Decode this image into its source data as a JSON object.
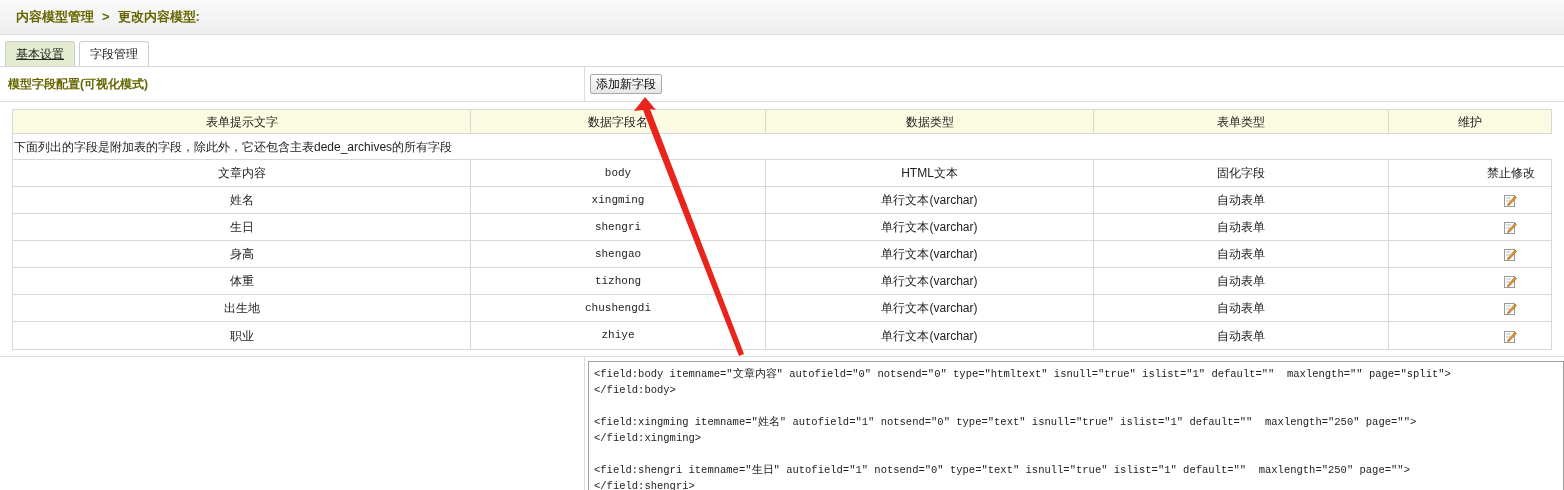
{
  "breadcrumb": {
    "parent": "内容模型管理",
    "separator": ">",
    "current": "更改内容模型:"
  },
  "tabs": [
    {
      "label": "基本设置",
      "selected": true
    },
    {
      "label": "字段管理",
      "selected": false
    }
  ],
  "section": {
    "title": "模型字段配置(可视化模式)",
    "button": "添加新字段"
  },
  "table": {
    "columns": [
      "表单提示文字",
      "数据字段名",
      "数据类型",
      "表单类型",
      "维护"
    ],
    "note": "下面列出的字段是附加表的字段，除此外，它还包含主表dede_archives的所有字段",
    "rows": [
      {
        "label": "文章内容",
        "field": "body",
        "data_type": "HTML文本",
        "form_type": "固化字段",
        "action": {
          "kind": "text",
          "text": "禁止修改"
        }
      },
      {
        "label": "姓名",
        "field": "xingming",
        "data_type": "单行文本(varchar)",
        "form_type": "自动表单",
        "action": {
          "kind": "edit"
        }
      },
      {
        "label": "生日",
        "field": "shengri",
        "data_type": "单行文本(varchar)",
        "form_type": "自动表单",
        "action": {
          "kind": "edit"
        }
      },
      {
        "label": "身高",
        "field": "shengao",
        "data_type": "单行文本(varchar)",
        "form_type": "自动表单",
        "action": {
          "kind": "edit"
        }
      },
      {
        "label": "体重",
        "field": "tizhong",
        "data_type": "单行文本(varchar)",
        "form_type": "自动表单",
        "action": {
          "kind": "edit"
        }
      },
      {
        "label": "出生地",
        "field": "chushengdi",
        "data_type": "单行文本(varchar)",
        "form_type": "自动表单",
        "action": {
          "kind": "edit"
        }
      },
      {
        "label": "职业",
        "field": "zhiye",
        "data_type": "单行文本(varchar)",
        "form_type": "自动表单",
        "action": {
          "kind": "edit"
        }
      }
    ]
  },
  "code_blocks": [
    [
      "<field:body itemname=\"文章内容\" autofield=\"0\" notsend=\"0\" type=\"htmltext\" isnull=\"true\" islist=\"1\" default=\"\"  maxlength=\"\" page=\"split\">",
      "</field:body>"
    ],
    [
      "<field:xingming itemname=\"姓名\" autofield=\"1\" notsend=\"0\" type=\"text\" isnull=\"true\" islist=\"1\" default=\"\"  maxlength=\"250\" page=\"\">",
      "</field:xingming>"
    ],
    [
      "<field:shengri itemname=\"生日\" autofield=\"1\" notsend=\"0\" type=\"text\" isnull=\"true\" islist=\"1\" default=\"\"  maxlength=\"250\" page=\"\">",
      "</field:shengri>"
    ]
  ]
}
